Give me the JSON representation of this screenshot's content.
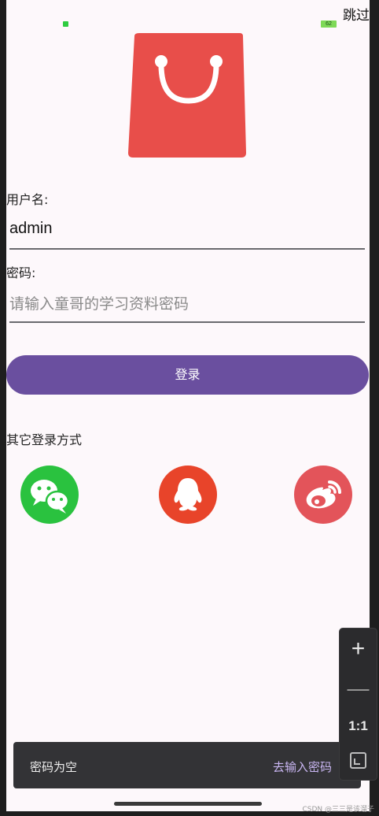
{
  "status_bar": {
    "battery": "62"
  },
  "header": {
    "skip_label": "跳过"
  },
  "form": {
    "username_label": "用户名:",
    "username_value": "admin",
    "password_label": "密码:",
    "password_placeholder": "请输入童哥的学习资料密码"
  },
  "login_button": "登录",
  "other_login": {
    "title": "其它登录方式",
    "providers": [
      {
        "name": "wechat",
        "icon": "wechat-icon",
        "color": "#2ac23f"
      },
      {
        "name": "qq",
        "icon": "qq-icon",
        "color": "#e8442a"
      },
      {
        "name": "weibo",
        "icon": "weibo-icon",
        "color": "#e3545a"
      }
    ]
  },
  "snackbar": {
    "message": "密码为空",
    "action": "去输入密码"
  },
  "zoom_controls": {
    "plus": "+",
    "minus": "—",
    "reset": "1:1"
  },
  "watermark": "CSDN @三三是该溜子",
  "colors": {
    "accent": "#6a4f9f",
    "logo": "#e84e4a",
    "background": "#fdf8fb"
  }
}
